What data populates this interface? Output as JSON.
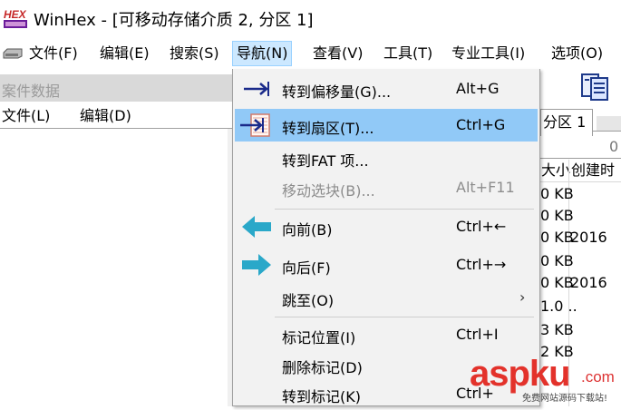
{
  "window": {
    "title": "WinHex - [可移动存储介质 2, 分区 1]"
  },
  "menubar": {
    "items": [
      {
        "label": "文件(F)"
      },
      {
        "label": "编辑(E)"
      },
      {
        "label": "搜索(S)"
      },
      {
        "label": "导航(N)"
      },
      {
        "label": "查看(V)"
      },
      {
        "label": "工具(T)"
      },
      {
        "label": "专业工具(I)"
      },
      {
        "label": "选项(O)"
      }
    ]
  },
  "case_panel": {
    "title": "案件数据",
    "menu": [
      {
        "label": "文件(L)"
      },
      {
        "label": "编辑(D)"
      }
    ]
  },
  "nav_menu": {
    "items": [
      {
        "label": "转到偏移量(G)...",
        "shortcut": "Alt+G",
        "icon": "arrow-right-to-bar-icon",
        "disabled": false
      },
      {
        "label": "转到扇区(T)...",
        "shortcut": "Ctrl+G",
        "icon": "goto-sector-icon",
        "disabled": false,
        "highlighted": true
      },
      {
        "label": "转到FAT 项...",
        "shortcut": "",
        "disabled": false
      },
      {
        "label": "移动选块(B)...",
        "shortcut": "Alt+F11",
        "disabled": true
      },
      {
        "label": "向前(B)",
        "shortcut": "Ctrl+←",
        "icon": "back-arrow-icon",
        "disabled": false
      },
      {
        "label": "向后(F)",
        "shortcut": "Ctrl+→",
        "icon": "forward-arrow-icon",
        "disabled": false
      },
      {
        "label": "跳至(O)",
        "shortcut": "",
        "submenu": true,
        "disabled": false
      },
      {
        "label": "标记位置(I)",
        "shortcut": "Ctrl+I",
        "disabled": false
      },
      {
        "label": "删除标记(D)",
        "shortcut": "",
        "disabled": false
      },
      {
        "label": "转到标记(K)",
        "shortcut": "Ctrl+",
        "disabled": false
      }
    ]
  },
  "right_panel": {
    "tab_label": "分区 1",
    "ruler_value": "0",
    "columns": [
      "大小",
      "创建时"
    ],
    "rows": [
      {
        "size": "0 KB",
        "date": ""
      },
      {
        "size": "0 KB",
        "date": ""
      },
      {
        "size": "0 KB",
        "date": "2016"
      },
      {
        "size": "0 KB",
        "date": ""
      },
      {
        "size": "0 KB",
        "date": "2016"
      },
      {
        "size": "1.0 ..",
        "date": ""
      },
      {
        "size": "3 KB",
        "date": ""
      },
      {
        "size": "2 KB",
        "date": ""
      }
    ]
  },
  "watermark": {
    "brand": "aspku",
    "suffix": ".com",
    "tagline": "免费网站源码下载站!"
  },
  "colors": {
    "highlight": "#91c9f7",
    "menu_bg": "#f2f2f2",
    "active_menu": "#cce8ff",
    "arrow_teal": "#2aa8c9",
    "arrow_navy": "#1a2a8a",
    "watermark_red": "#e3322b"
  }
}
